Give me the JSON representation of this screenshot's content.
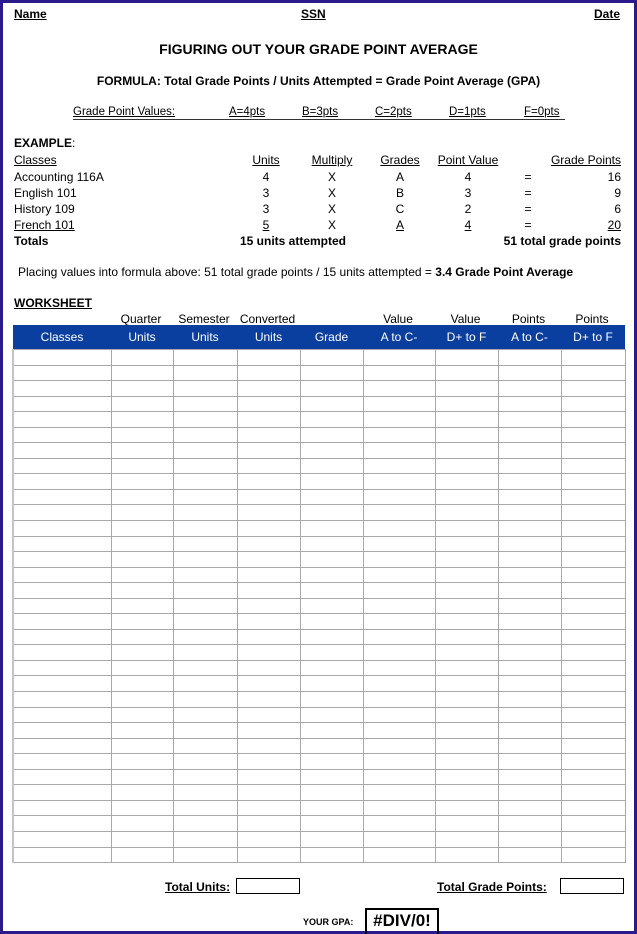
{
  "header": {
    "name_label": "Name",
    "ssn_label": "SSN",
    "date_label": "Date"
  },
  "title": "FIGURING OUT YOUR GRADE POINT AVERAGE",
  "formula": "FORMULA:  Total Grade Points / Units Attempted = Grade Point Average (GPA)",
  "grade_point_values": {
    "label": "Grade Point Values:",
    "values": [
      "A=4pts",
      "B=3pts",
      "C=2pts",
      "D=1pts",
      "F=0pts"
    ]
  },
  "example": {
    "heading": "EXAMPLE",
    "heading_suffix": ":",
    "columns": {
      "classes": "Classes",
      "units": "Units",
      "multiply": "Multiply",
      "grades": "Grades",
      "point_value": "Point Value",
      "grade_points": "Grade Points"
    },
    "rows": [
      {
        "class": "Accounting 116A",
        "units": "4",
        "multiply": "X",
        "grade": "A",
        "point_value": "4",
        "eq": "=",
        "grade_points": "16"
      },
      {
        "class": "English 101",
        "units": "3",
        "multiply": "X",
        "grade": "B",
        "point_value": "3",
        "eq": "=",
        "grade_points": "9"
      },
      {
        "class": "History 109",
        "units": "3",
        "multiply": "X",
        "grade": "C",
        "point_value": "2",
        "eq": "=",
        "grade_points": "6"
      },
      {
        "class": "French 101",
        "units": "5",
        "multiply": "X",
        "grade": "A",
        "point_value": "4",
        "eq": "=",
        "grade_points": "20"
      }
    ],
    "totals": {
      "label": "Totals",
      "units": "15 units attempted",
      "grade_points": "51 total grade points"
    }
  },
  "placing": {
    "text": "Placing values into formula above:  51 total grade points / 15 units attempted = ",
    "result": "3.4 Grade Point Average"
  },
  "worksheet": {
    "title": "WORKSHEET",
    "top_labels": [
      "",
      "Quarter",
      "Semester",
      "Converted",
      "",
      "Value",
      "Value",
      "Points",
      "Points"
    ],
    "headers": [
      "Classes",
      "Units",
      "Units",
      "Units",
      "Grade",
      "A to C-",
      "D+ to F",
      "A to C-",
      "D+ to F"
    ],
    "row_count": 33,
    "header_color": "#0b3f9f"
  },
  "totals": {
    "total_units_label": "Total Units:",
    "total_units_value": "",
    "total_grade_points_label": "Total Grade Points:",
    "total_grade_points_value": ""
  },
  "gpa": {
    "label": "YOUR GPA:",
    "value": "#DIV/0!"
  }
}
